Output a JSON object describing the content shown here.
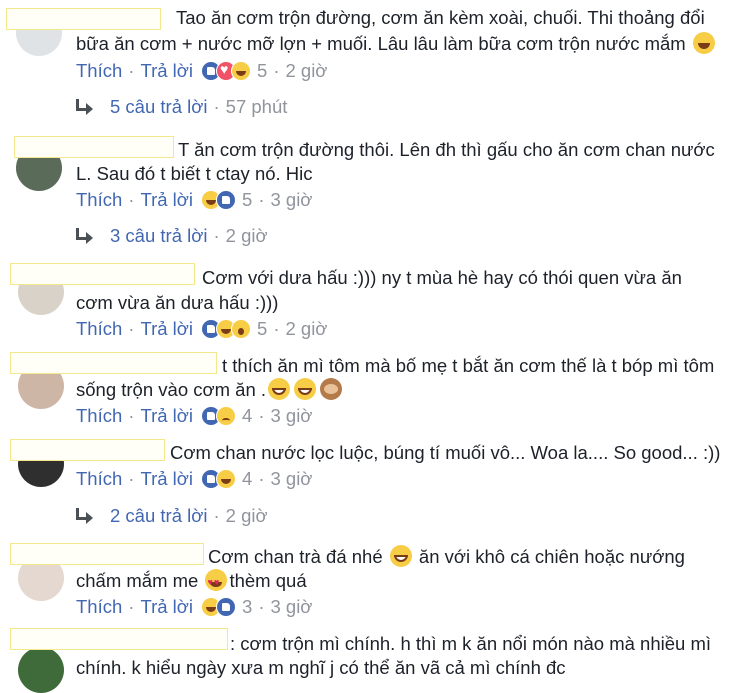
{
  "actions": {
    "like": "Thích",
    "reply": "Trả lời",
    "sep": "·"
  },
  "comments": [
    {
      "text_lines": [
        "Tao ăn cơm trộn đường, cơm ăn kèm xoài, chuối. Thi thoảng đổi",
        "bữa ăn cơm + nước mỡ lợn + muối. Lâu lâu làm bữa cơm trộn nước mắm"
      ],
      "reaction_count": "5",
      "time": "2 giờ",
      "replies": {
        "label": "5 câu trả lời",
        "time": "57 phút"
      }
    },
    {
      "text_lines": [
        "T ăn cơm trộn đường thôi. Lên đh thì gấu cho ăn cơm chan nước",
        "L. Sau đó t biết t ctay nó. Hic"
      ],
      "reaction_count": "5",
      "time": "3 giờ",
      "replies": {
        "label": "3 câu trả lời",
        "time": "2 giờ"
      }
    },
    {
      "text_lines": [
        "Cơm với dưa hấu :))) ny t mùa hè hay có thói quen vừa ăn",
        "cơm vừa ăn dưa hấu :)))"
      ],
      "reaction_count": "5",
      "time": "2 giờ"
    },
    {
      "text_lines": [
        "t thích ăn mì tôm mà bố mẹ t bắt ăn cơm thế là t bóp mì tôm",
        "sống trộn vào cơm ăn ."
      ],
      "reaction_count": "4",
      "time": "3 giờ"
    },
    {
      "text_lines": [
        "Cơm chan nước lọc luộc, búng tí muối vô... Woa la.... So good... :))"
      ],
      "reaction_count": "4",
      "time": "3 giờ",
      "replies": {
        "label": "2 câu trả lời",
        "time": "2 giờ"
      }
    },
    {
      "text_lines": [
        "Cơm chan trà đá nhé",
        "ăn với khô cá chiên hoặc nướng",
        "chấm mắm me",
        "thèm quá"
      ],
      "reaction_count": "3",
      "time": "3 giờ"
    },
    {
      "text_lines": [
        ": cơm trộn mì chính. h thì m k ăn nổi món nào mà nhiều mì",
        "chính. k hiểu ngày xưa m nghĩ j có thể ăn vã cả mì chính đc"
      ]
    }
  ],
  "colors": {
    "link": "#4267b2",
    "meta": "#90949c",
    "text": "#1d2129",
    "redaction_border": "#f3e98c"
  }
}
